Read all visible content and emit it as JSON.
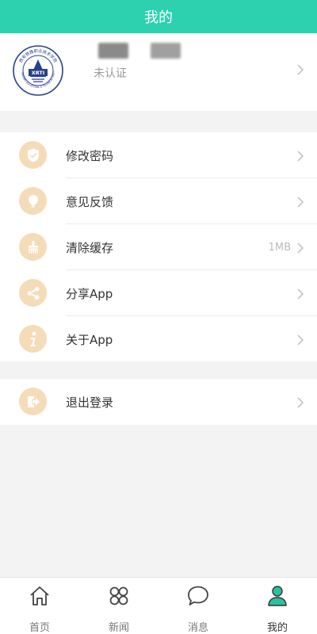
{
  "header": {
    "title": "我的"
  },
  "profile": {
    "status": "未认证",
    "logo_text_top": "西安铁路职业技术学院",
    "logo_text_center": "XRTI",
    "logo_text_bottom": "XI'AN RAILWAY VOCATIONAL & TECHNICAL INSTITUTE"
  },
  "menu": {
    "group1": [
      {
        "label": "修改密码",
        "value": ""
      },
      {
        "label": "意见反馈",
        "value": ""
      },
      {
        "label": "清除缓存",
        "value": "1MB"
      },
      {
        "label": "分享App",
        "value": ""
      },
      {
        "label": "关于App",
        "value": ""
      }
    ],
    "group2": [
      {
        "label": "退出登录",
        "value": ""
      }
    ]
  },
  "nav": [
    {
      "label": "首页"
    },
    {
      "label": "新闻"
    },
    {
      "label": "消息"
    },
    {
      "label": "我的"
    }
  ],
  "colors": {
    "accent": "#2dd1b0",
    "icon_bg": "#f5dcb8",
    "nav_active": "#2dbf9f"
  }
}
